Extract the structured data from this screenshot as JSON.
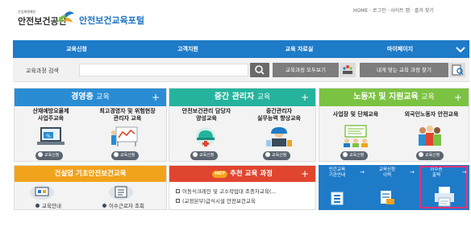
{
  "header": {
    "org_small": "산업재해예방",
    "org_name": "안전보건공단",
    "portal_name": "안전보건교육포털",
    "util_links": "HOME · 로그인 · 사이트 맵 · 즐겨 찾기"
  },
  "nav": {
    "items": [
      {
        "label": "교육신청"
      },
      {
        "label": "고객지원"
      },
      {
        "label": "교육 자료실"
      },
      {
        "label": "마이페이지"
      }
    ]
  },
  "search": {
    "label": "교육과정 검색",
    "placeholder": "",
    "view_all_label": "교육과정 모두보기",
    "find_mine_label": "내게 맞는 교육 과정 찾기"
  },
  "panels": {
    "management": {
      "title": "경영층",
      "suffix": "교육",
      "color": "#2a8dd4",
      "cols": [
        {
          "title": "산재예방요율제\n사업주교육",
          "button": "교육신청"
        },
        {
          "title": "최고경영자 및 위험현장\n관리자 교육",
          "button": "교육신청"
        }
      ]
    },
    "middle": {
      "title": "중간 관리자",
      "suffix": "교육",
      "color": "#25b39e",
      "cols": [
        {
          "title": "안전보건관리 담당자\n양성교육",
          "button": "교육신청"
        },
        {
          "title": "중간관리자\n실무능력 향상교육",
          "button": "교육신청"
        }
      ]
    },
    "worker": {
      "title": "노동자 및 지원교육",
      "suffix": "교육",
      "color": "#7cc242",
      "cols": [
        {
          "title": "사업장 및 단체교육",
          "button": "교육신청"
        },
        {
          "title": "외국인노동자 안전교육",
          "button": "교육신청"
        }
      ]
    },
    "construction": {
      "title": "건설업 기초안전보건교육",
      "color": "#f2a31c",
      "links": [
        {
          "label": "교육안내"
        },
        {
          "label": "이수근로자 조회"
        }
      ]
    },
    "recommend": {
      "badge": "HOT",
      "title": "추천 교육 과정",
      "color": "#e0452f",
      "items": [
        {
          "label": "이동식크레인 및 고소작업대 조종자교육(..."
        },
        {
          "label": "(교정본부)급식시설 안전보건교육"
        }
      ]
    },
    "quick": {
      "tiles": [
        {
          "label": "민간교육\n기관안내"
        },
        {
          "label": "교육신청\n이력"
        },
        {
          "label": "이수증\n출력"
        }
      ]
    }
  }
}
